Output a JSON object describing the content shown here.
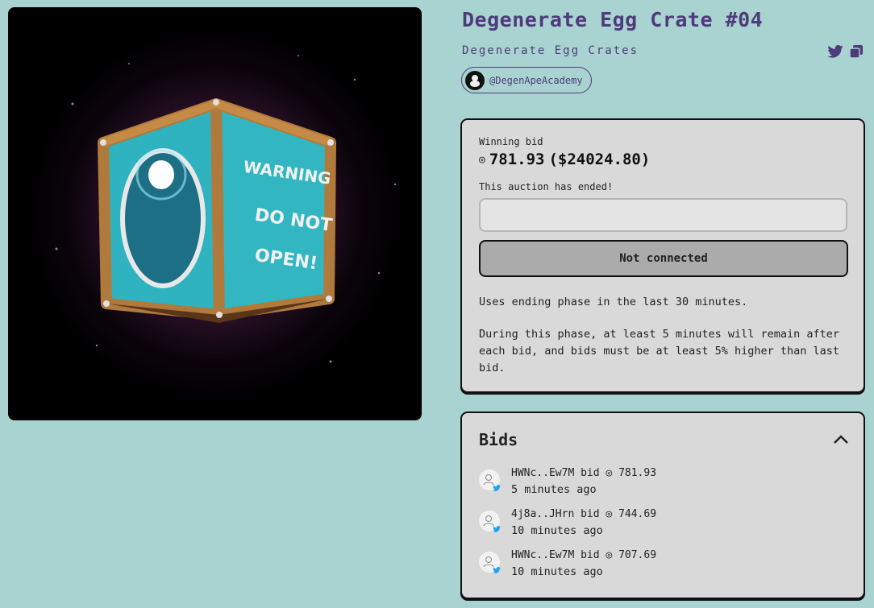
{
  "artwork": {
    "name": "egg-crate-artwork",
    "crate_text": [
      "WARNING",
      "DO NOT",
      "OPEN!"
    ]
  },
  "header": {
    "title": "Degenerate Egg Crate #04",
    "collection": "Degenerate Egg Crates",
    "creator_handle": "@DegenApeAcademy"
  },
  "auction": {
    "winning_label": "Winning bid",
    "winning_amount": "781.93",
    "winning_usd": "($24024.80)",
    "status": "This auction has ended!",
    "input_value": "",
    "button_label": "Not connected",
    "info_1": "Uses ending phase in the last 30 minutes.",
    "info_2": "During this phase, at least 5 minutes will remain after each bid, and bids must be at least 5% higher than last bid."
  },
  "bids": {
    "title": "Bids",
    "items": [
      {
        "bidder": "HWNc..Ew7M",
        "verb": "bid",
        "amount": "781.93",
        "time": "5 minutes ago"
      },
      {
        "bidder": "4j8a..JHrn",
        "verb": "bid",
        "amount": "744.69",
        "time": "10 minutes ago"
      },
      {
        "bidder": "HWNc..Ew7M",
        "verb": "bid",
        "amount": "707.69",
        "time": "10 minutes ago"
      }
    ]
  },
  "icons": {
    "sol_symbol": "◎",
    "twitter": "twitter-icon",
    "copy": "copy-icon"
  },
  "colors": {
    "background": "#a8d3d0",
    "accent": "#4e3b7a",
    "panel": "#d9d9d9",
    "button": "#ababab"
  }
}
